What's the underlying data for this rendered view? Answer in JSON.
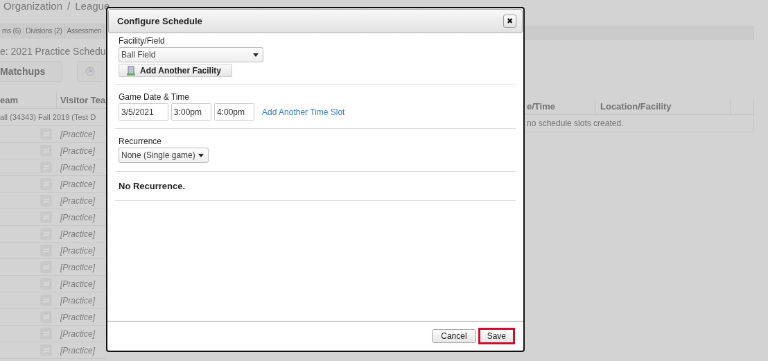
{
  "background": {
    "breadcrumb": [
      "Organization",
      "/",
      "League"
    ],
    "tabs": [
      "ms (6)",
      "Divisions (2)",
      "Assessmen"
    ],
    "title": "e: 2021 Practice Schedu",
    "matchups_button": "Matchups",
    "table": {
      "columns_left": [
        "eam",
        "Visitor Tea"
      ],
      "columns_right": [
        "e/Time",
        "Location/Facility"
      ],
      "group_row": "all (34343) Fall 2019 (Test D",
      "empty_message": "no schedule slots created.",
      "rows": [
        {
          "opponent": "[Practice]"
        },
        {
          "opponent": "[Practice]"
        },
        {
          "opponent": "[Practice]"
        },
        {
          "opponent": "[Practice]"
        },
        {
          "opponent": "[Practice]"
        },
        {
          "opponent": "[Practice]"
        },
        {
          "opponent": "[Practice]"
        },
        {
          "opponent": "[Practice]"
        },
        {
          "opponent": "[Practice]"
        },
        {
          "opponent": "[Practice]"
        },
        {
          "opponent": "[Practice]"
        },
        {
          "opponent": "[Practice]"
        },
        {
          "opponent": "[Practice]"
        },
        {
          "opponent": "[Practice]"
        }
      ]
    }
  },
  "dialog": {
    "title": "Configure Schedule",
    "close": "✖",
    "facility": {
      "label": "Facility/Field",
      "value": "Ball Field",
      "add_button": "Add Another Facility"
    },
    "date_time": {
      "label": "Game Date & Time",
      "date": "3/5/2021",
      "start": "3:00pm",
      "end": "4:00pm",
      "add_link": "Add Another Time Slot"
    },
    "recurrence": {
      "label": "Recurrence",
      "value": "None (Single game)",
      "note": "No Recurrence."
    },
    "buttons": [
      {
        "label": "Cancel",
        "highlighted": false
      },
      {
        "label": "Save",
        "highlighted": true
      }
    ]
  }
}
